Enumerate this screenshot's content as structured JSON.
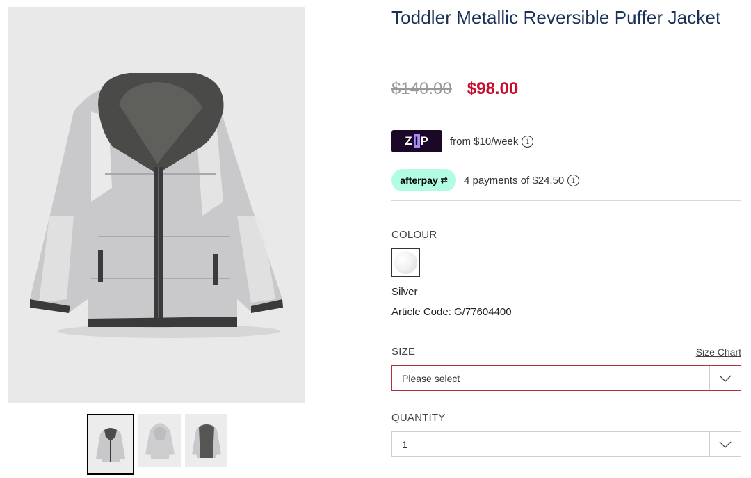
{
  "product": {
    "title": "Toddler Metallic Reversible Puffer Jacket",
    "price_original": "$140.00",
    "price_sale": "$98.00"
  },
  "payments": {
    "zip_logo": "zip",
    "zip_text": "from $10/week",
    "afterpay_logo": "afterpay",
    "afterpay_text": "4 payments of $24.50"
  },
  "colour": {
    "label": "COLOUR",
    "selected": "Silver",
    "article_code": "Article Code: G/77604400"
  },
  "size": {
    "label": "SIZE",
    "chart_link": "Size Chart",
    "placeholder": "Please select"
  },
  "quantity": {
    "label": "QUANTITY",
    "value": "1"
  },
  "gallery": {
    "thumbnail_count": 3,
    "selected_index": 0
  },
  "colors": {
    "title": "#1a3158",
    "sale_price": "#c8102e",
    "zip_brand": "#1a0826",
    "afterpay_brand": "#b2fce4"
  }
}
